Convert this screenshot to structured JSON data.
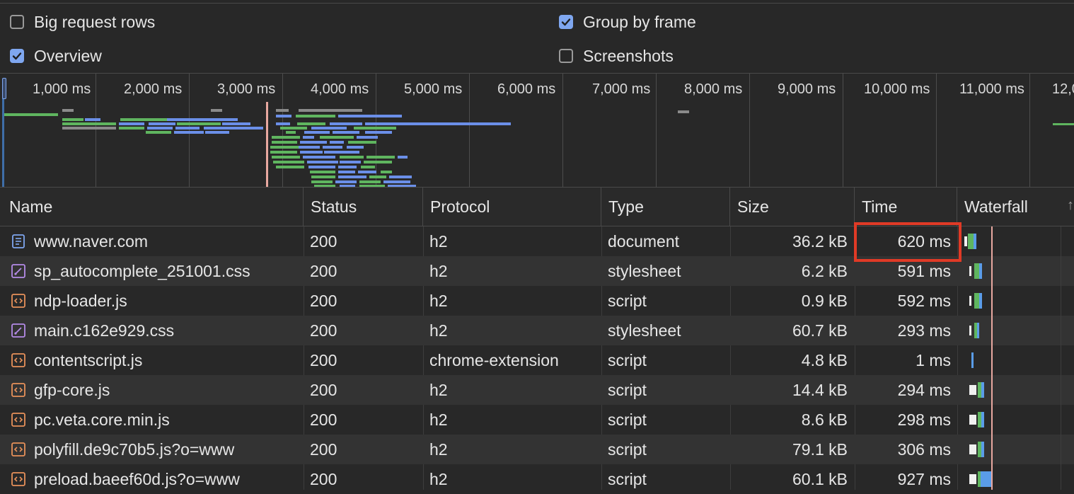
{
  "settings": {
    "big_request_rows": {
      "label": "Big request rows",
      "checked": false
    },
    "group_by_frame": {
      "label": "Group by frame",
      "checked": true
    },
    "overview": {
      "label": "Overview",
      "checked": true
    },
    "screenshots": {
      "label": "Screenshots",
      "checked": false
    }
  },
  "overview": {
    "ticks": [
      "1,000 ms",
      "2,000 ms",
      "3,000 ms",
      "4,000 ms",
      "5,000 ms",
      "6,000 ms",
      "7,000 ms",
      "8,000 ms",
      "9,000 ms",
      "10,000 ms",
      "11,000 ms",
      "12,0"
    ]
  },
  "columns": {
    "name": "Name",
    "status": "Status",
    "protocol": "Protocol",
    "type": "Type",
    "size": "Size",
    "time": "Time",
    "waterfall": "Waterfall"
  },
  "rows": [
    {
      "name": "www.naver.com",
      "icon": "document-icon",
      "status": "200",
      "protocol": "h2",
      "type": "document",
      "size": "36.2 kB",
      "time": "620 ms"
    },
    {
      "name": "sp_autocomplete_251001.css",
      "icon": "stylesheet-icon",
      "status": "200",
      "protocol": "h2",
      "type": "stylesheet",
      "size": "6.2 kB",
      "time": "591 ms"
    },
    {
      "name": "ndp-loader.js",
      "icon": "script-icon",
      "status": "200",
      "protocol": "h2",
      "type": "script",
      "size": "0.9 kB",
      "time": "592 ms"
    },
    {
      "name": "main.c162e929.css",
      "icon": "stylesheet-icon",
      "status": "200",
      "protocol": "h2",
      "type": "stylesheet",
      "size": "60.7 kB",
      "time": "293 ms"
    },
    {
      "name": "contentscript.js",
      "icon": "script-icon",
      "status": "200",
      "protocol": "chrome-extension",
      "type": "script",
      "size": "4.8 kB",
      "time": "1 ms"
    },
    {
      "name": "gfp-core.js",
      "icon": "script-icon",
      "status": "200",
      "protocol": "h2",
      "type": "script",
      "size": "14.4 kB",
      "time": "294 ms"
    },
    {
      "name": "pc.veta.core.min.js",
      "icon": "script-icon",
      "status": "200",
      "protocol": "h2",
      "type": "script",
      "size": "8.6 kB",
      "time": "298 ms"
    },
    {
      "name": "polyfill.de9c70b5.js?o=www",
      "icon": "script-icon",
      "status": "200",
      "protocol": "h2",
      "type": "script",
      "size": "79.1 kB",
      "time": "306 ms"
    },
    {
      "name": "preload.baeef60d.js?o=www",
      "icon": "script-icon",
      "status": "200",
      "protocol": "h2",
      "type": "script",
      "size": "60.1 kB",
      "time": "927 ms"
    }
  ],
  "colors": {
    "green": "#5fb55f",
    "blue": "#6b8fe8",
    "gray": "#8a8a8a",
    "highlight": "#e03a26",
    "checkbox": "#7fa7f0"
  }
}
